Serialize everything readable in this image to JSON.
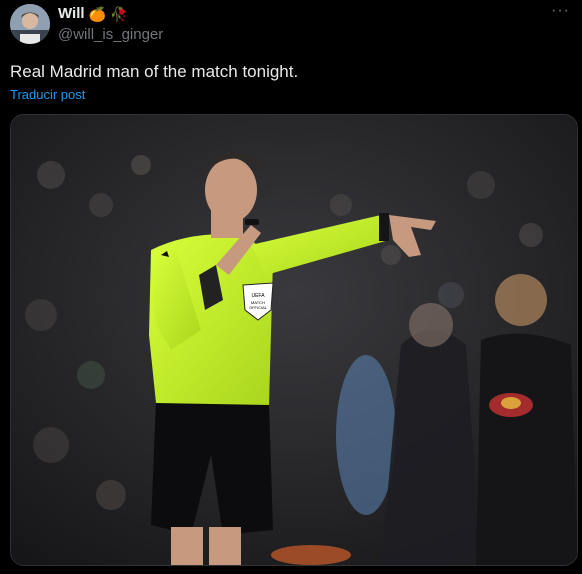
{
  "author": {
    "name": "Will",
    "handle": "@will_is_ginger",
    "badges": [
      "orange-emoji",
      "rose-emoji"
    ]
  },
  "tweet": {
    "text": "Real Madrid man of the match tonight.",
    "translate_label": "Traducir post",
    "more_label": "···"
  },
  "photo": {
    "badge_text_1": "UEFA",
    "badge_text_2": "MATCH",
    "badge_text_3": "OFFICIAL"
  },
  "colors": {
    "background": "#000000",
    "text": "#e7e9ea",
    "muted": "#71767b",
    "link": "#1d9bf0",
    "referee_shirt": "#c8f52a"
  }
}
